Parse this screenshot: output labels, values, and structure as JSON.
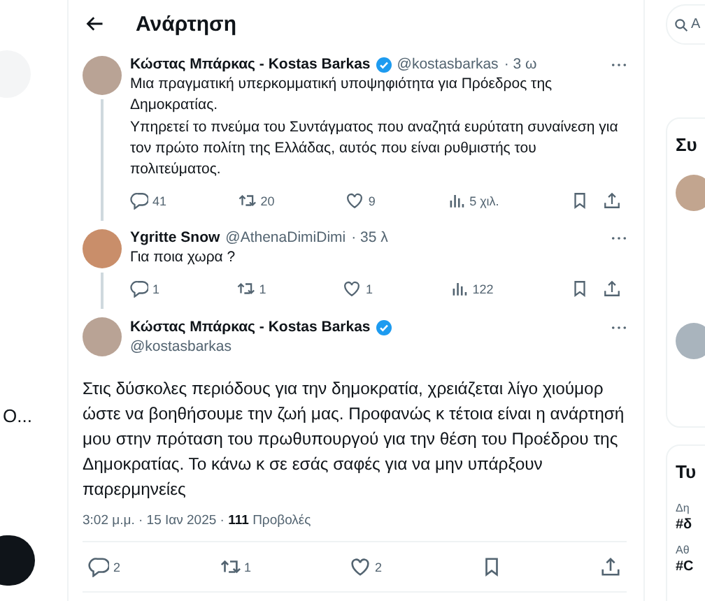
{
  "left_sidebar": {
    "item_text": "Ο..."
  },
  "header": {
    "title": "Ανάρτηση"
  },
  "thread": [
    {
      "author": "Κώστας Μπάρκας - Kostas Barkas",
      "verified": true,
      "handle": "@kostasbarkas",
      "time": "· 3 ω",
      "paragraphs": [
        "Μια πραγματική υπερκομματική υποψηφιότητα για Πρόεδρος της Δημοκρατίας.",
        "Υπηρετεί το πνεύμα του Συντάγματος που αναζητά ευρύτατη συναίνεση για τον πρώτο πολίτη της Ελλάδας, αυτός που είναι ρυθμιστής του πολιτεύματος."
      ],
      "replies": "41",
      "reposts": "20",
      "likes": "9",
      "views": "5 χιλ."
    },
    {
      "author": "Ygritte Snow",
      "verified": false,
      "handle": "@AthenaDimiDimi",
      "time": "· 35 λ",
      "paragraphs": [
        "Για ποια χωρα ?"
      ],
      "replies": "1",
      "reposts": "1",
      "likes": "1",
      "views": "122"
    }
  ],
  "main_post": {
    "author": "Κώστας Μπάρκας - Kostas Barkas",
    "verified": true,
    "handle": "@kostasbarkas",
    "text": "Στις δύσκολες περιόδους για την δημοκρατία, χρειάζεται λίγο χιούμορ ώστε να βοηθήσουμε την ζωή μας. Προφανώς κ τέτοια είναι η ανάρτησή μου στην πρόταση του πρωθυπουργού για την θέση του Προέδρου της Δημοκρατίας. Το κάνω κ σε εσάς σαφές για να μην υπάρξουν παρερμηνείες",
    "timestamp": "3:02 μ.μ. · 15 Ιαν 2025 ·",
    "views_count": "111",
    "views_label": "Προβολές",
    "replies": "2",
    "reposts": "1",
    "likes": "2"
  },
  "right_sidebar": {
    "search_placeholder": "Α",
    "suggestions_title": "Συ",
    "trends_title": "Τυ",
    "trends": [
      {
        "category": "Δη",
        "tag": "#δ"
      },
      {
        "category": "Αθ",
        "tag": "#C"
      }
    ]
  }
}
